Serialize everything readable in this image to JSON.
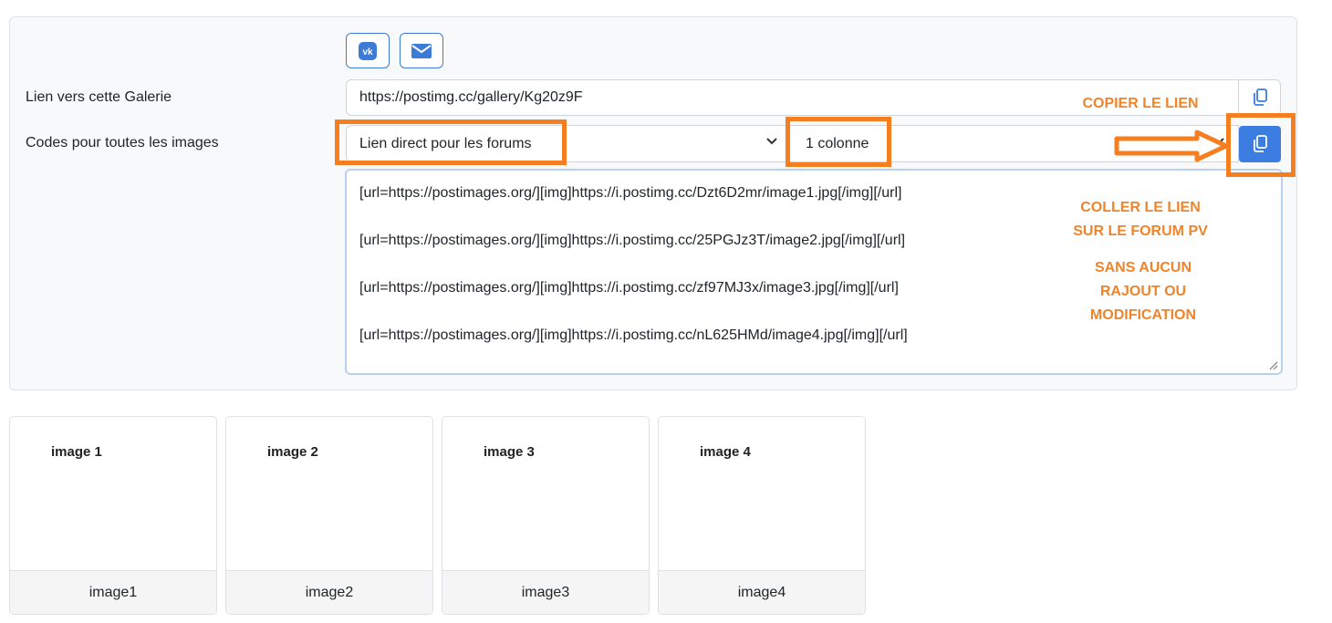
{
  "gallery": {
    "link_label": "Lien vers cette Galerie",
    "link_value": "https://postimg.cc/gallery/Kg20z9F",
    "codes_label": "Codes pour toutes les images",
    "code_type_selected": "Lien direct pour les forums",
    "columns_selected": "1 colonne",
    "codes_lines": [
      "[url=https://postimages.org/][img]https://i.postimg.cc/Dzt6D2mr/image1.jpg[/img][/url]",
      "[url=https://postimages.org/][img]https://i.postimg.cc/25PGJz3T/image2.jpg[/img][/url]",
      "[url=https://postimages.org/][img]https://i.postimg.cc/zf97MJ3x/image3.jpg[/img][/url]",
      "[url=https://postimages.org/][img]https://i.postimg.cc/nL625HMd/image4.jpg[/img][/url]"
    ]
  },
  "share": {
    "vk_icon": "vk-icon",
    "email_icon": "email-icon"
  },
  "annotations": {
    "copy_link": "COPIER LE LIEN",
    "paste_line1": "COLLER LE LIEN",
    "paste_line2": "SUR LE FORUM PV",
    "no_change_line1": "SANS AUCUN",
    "no_change_line2": "RAJOUT OU",
    "no_change_line3": "MODIFICATION"
  },
  "thumbnails": [
    {
      "image_text": "image 1",
      "caption": "image1"
    },
    {
      "image_text": "image 2",
      "caption": "image2"
    },
    {
      "image_text": "image 3",
      "caption": "image3"
    },
    {
      "image_text": "image 4",
      "caption": "image4"
    }
  ],
  "colors": {
    "accent_blue": "#3b7de0",
    "annotation_orange": "#f57f20"
  }
}
